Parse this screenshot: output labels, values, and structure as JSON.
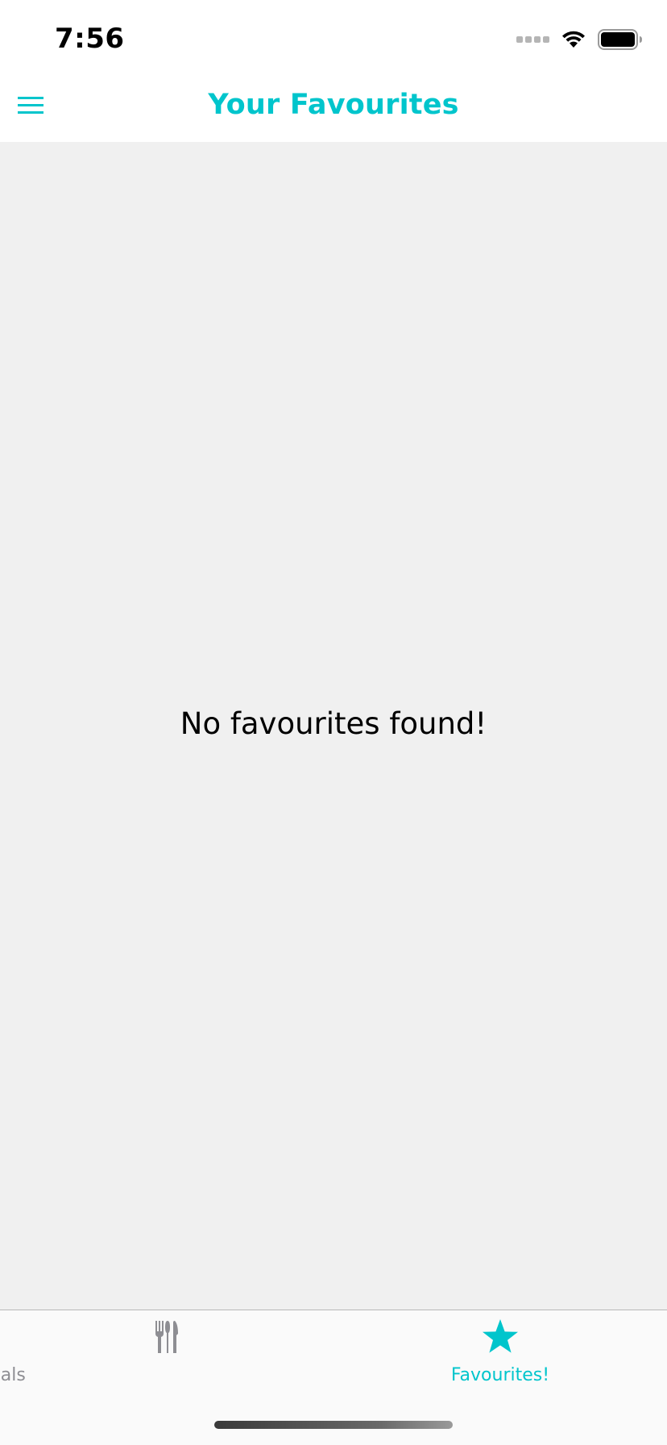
{
  "status_bar": {
    "time": "7:56",
    "icons": [
      "signal-dots-icon",
      "wifi-icon",
      "battery-icon"
    ]
  },
  "header": {
    "title": "Your Favourites",
    "menu_icon": "hamburger-menu-icon"
  },
  "content": {
    "empty_message": "No favourites found!"
  },
  "tab_bar": {
    "tabs": [
      {
        "label": "Meals",
        "icon": "fork-knife-icon",
        "active": false
      },
      {
        "label": "Favourites!",
        "icon": "star-icon",
        "active": true
      }
    ]
  },
  "colors": {
    "accent": "#00c5cc",
    "inactive_tab": "#8e8e93",
    "content_background": "#f0f0f0",
    "header_background": "#ffffff"
  }
}
